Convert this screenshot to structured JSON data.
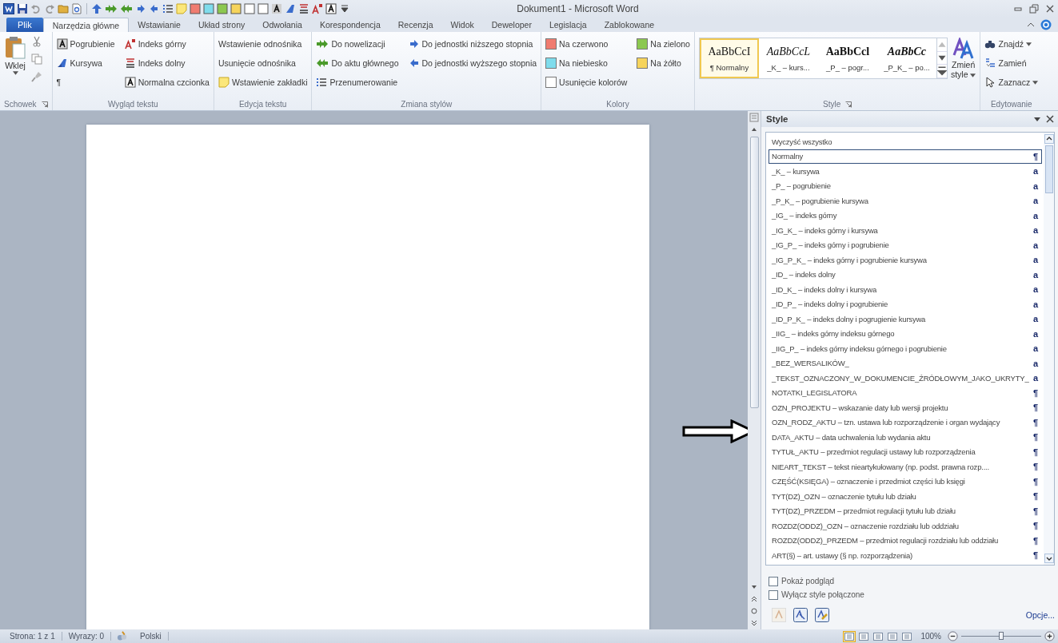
{
  "window": {
    "title": "Dokument1 - Microsoft Word"
  },
  "file_tab": {
    "label": "Plik"
  },
  "tabs": [
    {
      "label": "Narzędzia główne",
      "selected": true
    },
    {
      "label": "Wstawianie",
      "selected": false
    },
    {
      "label": "Układ strony",
      "selected": false
    },
    {
      "label": "Odwołania",
      "selected": false
    },
    {
      "label": "Korespondencja",
      "selected": false
    },
    {
      "label": "Recenzja",
      "selected": false
    },
    {
      "label": "Widok",
      "selected": false
    },
    {
      "label": "Deweloper",
      "selected": false
    },
    {
      "label": "Legislacja",
      "selected": false
    },
    {
      "label": "Zablokowane",
      "selected": false
    }
  ],
  "ribbon": {
    "clipboard": {
      "title": "Schowek",
      "launcher": true,
      "paste_label": "Wklej"
    },
    "button_groups": [
      {
        "title": "Wygląd tekstu",
        "items": [
          {
            "label": "Pogrubienie",
            "kind": "bold"
          },
          {
            "label": "Kursywa",
            "kind": "italic"
          },
          {
            "label": "¶",
            "kind": "plain"
          },
          {
            "label": "Indeks górny",
            "kind": "superscript"
          },
          {
            "label": "Indeks dolny",
            "kind": "subscript"
          },
          {
            "label": "Normalna czcionka",
            "kind": "normal"
          }
        ]
      },
      {
        "title": "Edycja tekstu",
        "items": [
          {
            "label": "Wstawienie odnośnika",
            "kind": "plain"
          },
          {
            "label": "Usunięcie odnośnika",
            "kind": "plain"
          },
          {
            "label": "Wstawienie zakładki",
            "kind": "note"
          }
        ]
      },
      {
        "title": "Zmiana stylów",
        "items": [
          {
            "label": "Do nowelizacji",
            "kind": "double-right"
          },
          {
            "label": "Do aktu głównego",
            "kind": "double-left"
          },
          {
            "label": "Przenumerowanie",
            "kind": "list"
          },
          {
            "label": "Do jednostki niższego stopnia",
            "kind": "right"
          },
          {
            "label": "Do jednostki wyższego stopnia",
            "kind": "left"
          }
        ]
      },
      {
        "title": "Kolory",
        "items": [
          {
            "label": "Na czerwono",
            "kind": "swatch",
            "color": "#f07c70"
          },
          {
            "label": "Na niebiesko",
            "kind": "swatch",
            "color": "#7fdcec"
          },
          {
            "label": "Usunięcie kolorów",
            "kind": "swatch",
            "color": "#ffffff"
          },
          {
            "label": "Na zielono",
            "kind": "swatch",
            "color": "#8cc850"
          },
          {
            "label": "Na żółto",
            "kind": "swatch",
            "color": "#f6d45c"
          }
        ]
      }
    ],
    "styles_gallery": {
      "title": "Style",
      "launcher": true,
      "items": [
        {
          "preview": "AaBbCcI",
          "label": "¶ Normalny",
          "kind": "normal",
          "selected": true
        },
        {
          "preview": "AaBbCcL",
          "label": "_K_ – kurs...",
          "kind": "italic",
          "selected": false
        },
        {
          "preview": "AaBbCcl",
          "label": "_P_ – pogr...",
          "kind": "bold",
          "selected": false
        },
        {
          "preview": "AaBbCc",
          "label": "_P_K_ – po...",
          "kind": "bold-italic",
          "selected": false
        }
      ],
      "change_styles": {
        "label": "Zmień",
        "sublabel": "style"
      }
    },
    "editing": {
      "title": "Edytowanie",
      "items": [
        {
          "label": "Znajdź",
          "kind": "find",
          "has_menu": true
        },
        {
          "label": "Zamień",
          "kind": "replace",
          "has_menu": false
        },
        {
          "label": "Zaznacz",
          "kind": "select",
          "has_menu": true
        }
      ]
    }
  },
  "styles_pane": {
    "title": "Style",
    "styles": [
      {
        "label": "Wyczyść wszystko",
        "selected": false
      },
      {
        "label": "Normalny",
        "mark": "¶",
        "selected": true
      },
      {
        "label": "_K_ – kursywa",
        "mark": "a",
        "selected": false
      },
      {
        "label": "_P_ – pogrubienie",
        "mark": "a",
        "selected": false
      },
      {
        "label": "_P_K_ – pogrubienie kursywa",
        "mark": "a",
        "selected": false
      },
      {
        "label": "_IG_ – indeks górny",
        "mark": "a",
        "selected": false
      },
      {
        "label": "_IG_K_ – indeks górny i kursywa",
        "mark": "a",
        "selected": false
      },
      {
        "label": "_IG_P_ – indeks górny i pogrubienie",
        "mark": "a",
        "selected": false
      },
      {
        "label": "_IG_P_K_ – indeks górny i pogrubienie kursywa",
        "mark": "a",
        "selected": false
      },
      {
        "label": "_ID_ – indeks dolny",
        "mark": "a",
        "selected": false
      },
      {
        "label": "_ID_K_ – indeks dolny i kursywa",
        "mark": "a",
        "selected": false
      },
      {
        "label": "_ID_P_ – indeks dolny i pogrubienie",
        "mark": "a",
        "selected": false
      },
      {
        "label": "_ID_P_K_ – indeks dolny i pogrugienie kursywa",
        "mark": "a",
        "selected": false
      },
      {
        "label": "_IIG_ – indeks górny indeksu górnego",
        "mark": "a",
        "selected": false
      },
      {
        "label": "_IIG_P_ – indeks górny indeksu górnego i pogrubienie",
        "mark": "a",
        "selected": false
      },
      {
        "label": "_BEZ_WERSALIKÓW_",
        "mark": "a",
        "selected": false
      },
      {
        "label": "_TEKST_OZNACZONY_W_DOKUMENCIE_ŹRÓDŁOWYM_JAKO_UKRYTY_",
        "mark": "a",
        "selected": false
      },
      {
        "label": "NOTATKI_LEGISLATORA",
        "mark": "¶",
        "selected": false
      },
      {
        "label": "OZN_PROJEKTU – wskazanie daty lub wersji projektu",
        "mark": "¶",
        "selected": false
      },
      {
        "label": "OZN_RODZ_AKTU – tzn. ustawa lub rozporządzenie i organ wydający",
        "mark": "¶",
        "selected": false
      },
      {
        "label": "DATA_AKTU – data uchwalenia lub wydania aktu",
        "mark": "¶",
        "selected": false
      },
      {
        "label": "TYTUŁ_AKTU – przedmiot regulacji ustawy lub rozporządzenia",
        "mark": "¶",
        "selected": false
      },
      {
        "label": "NIEART_TEKST – tekst nieartykułowany (np. podst. prawna rozp....",
        "mark": "¶",
        "selected": false
      },
      {
        "label": "CZĘŚĆ(KSIĘGA) – oznaczenie i przedmiot części lub księgi",
        "mark": "¶",
        "selected": false
      },
      {
        "label": "TYT(DZ)_OZN – oznaczenie tytułu lub działu",
        "mark": "¶",
        "selected": false
      },
      {
        "label": "TYT(DZ)_PRZEDM – przedmiot regulacji tytułu lub działu",
        "mark": "¶",
        "selected": false
      },
      {
        "label": "ROZDZ(ODDZ)_OZN – oznaczenie rozdziału lub oddziału",
        "mark": "¶",
        "selected": false
      },
      {
        "label": "ROZDZ(ODDZ)_PRZEDM – przedmiot regulacji rozdziału lub oddziału",
        "mark": "¶",
        "selected": false
      },
      {
        "label": "ART(§) – art. ustawy (§ np. rozporządzenia)",
        "mark": "¶",
        "selected": false
      }
    ],
    "checkboxes": [
      {
        "label": "Pokaż podgląd",
        "checked": false
      },
      {
        "label": "Wyłącz style połączone",
        "checked": false
      }
    ],
    "options_link": "Opcje..."
  },
  "status_bar": {
    "page": "Strona: 1 z 1",
    "words": "Wyrazy: 0",
    "language": "Polski",
    "views": [
      {
        "selected": true
      },
      {
        "selected": false
      },
      {
        "selected": false
      },
      {
        "selected": false
      },
      {
        "selected": false
      }
    ],
    "zoom": "100%",
    "zoom_slider": {
      "level": 0.5
    }
  }
}
